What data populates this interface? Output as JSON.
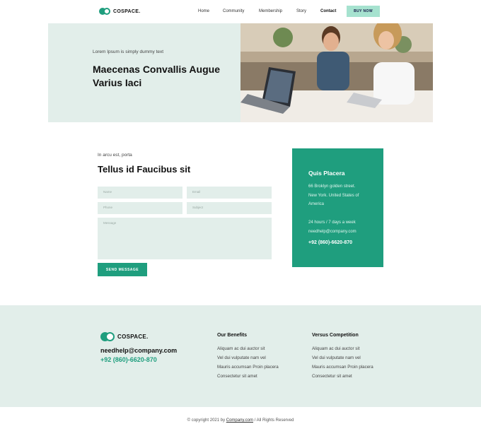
{
  "header": {
    "logo_text": "COSPACE.",
    "nav": [
      "Home",
      "Community",
      "Membership",
      "Story",
      "Contact"
    ],
    "active_nav": "Contact",
    "buy_label": "BUY NOW"
  },
  "hero": {
    "subtitle": "Lorem Ipsum is simply dummy text",
    "title": "Maecenas Convallis Augue Varius Iaci"
  },
  "contact": {
    "subtitle": "In arcu est, porta",
    "title": "Tellus id Faucibus sit",
    "placeholders": {
      "name": "Name",
      "email": "Email",
      "phone": "Phone",
      "subject": "Subject",
      "message": "Message"
    },
    "send_label": "SEND MESSAGE"
  },
  "info": {
    "title": "Quis Placera",
    "address1": "66 Broklyn golden street.",
    "address2": "New York. United States of",
    "address3": "America",
    "hours": "24 hours / 7 days a week",
    "email": "needhelp@company.com",
    "phone": "+92 (860)-6620-870"
  },
  "footer": {
    "logo_text": "COSPACE.",
    "email": "needhelp@company.com",
    "phone": "+92 (860)-6620-870",
    "benefits_title": "Our Benefits",
    "benefits": [
      "Aliquam ac dui auctor sit",
      "Vel dui vulputate nam vel",
      "Mauris accumsan Proin placera",
      "Consectetur sit amet"
    ],
    "versus_title": "Versus Competition",
    "versus": [
      "Aliquam ac dui auctor sit",
      "Vel dui vulputate nam vel",
      "Mauris accumsan Proin placera",
      "Consectetur sit amet"
    ],
    "copyright_pre": "© copyright 2021 by ",
    "copyright_link": "Company.com",
    "copyright_post": " / All Rights Reserved"
  },
  "colors": {
    "accent": "#1f9e7e",
    "mint_bg": "#e2eeea",
    "button_mint": "#a6e2cf"
  }
}
